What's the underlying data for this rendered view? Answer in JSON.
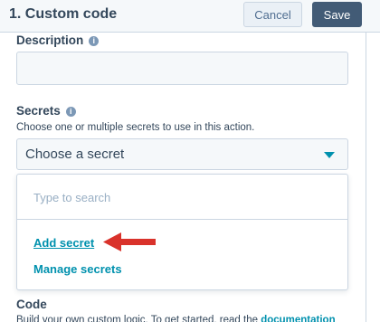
{
  "header": {
    "title": "1. Custom code",
    "cancel_label": "Cancel",
    "save_label": "Save"
  },
  "description": {
    "label": "Description",
    "value": ""
  },
  "secrets": {
    "label": "Secrets",
    "help": "Choose one or multiple secrets to use in this action.",
    "selected": "Choose a secret",
    "dropdown": {
      "search_placeholder": "Type to search",
      "add_label": "Add secret",
      "manage_label": "Manage secrets"
    }
  },
  "code": {
    "label": "Code",
    "help_prefix": "Build your own custom logic. To get started, read the ",
    "help_link": "documentation"
  },
  "colors": {
    "accent": "#0091ae",
    "annotation_arrow": "#d9322b",
    "save_button": "#425b76"
  }
}
